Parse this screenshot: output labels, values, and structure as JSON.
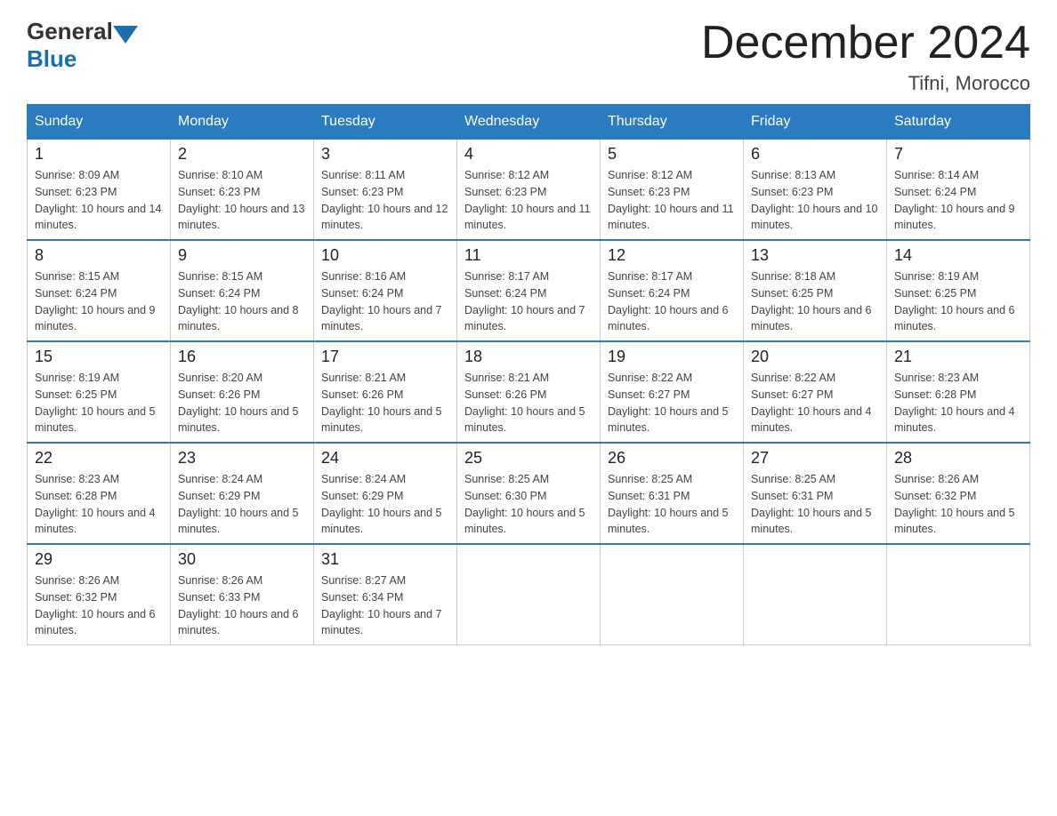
{
  "header": {
    "title": "December 2024",
    "location": "Tifni, Morocco",
    "logo_general": "General",
    "logo_blue": "Blue"
  },
  "days_of_week": [
    "Sunday",
    "Monday",
    "Tuesday",
    "Wednesday",
    "Thursday",
    "Friday",
    "Saturday"
  ],
  "weeks": [
    [
      {
        "day": "1",
        "sunrise": "8:09 AM",
        "sunset": "6:23 PM",
        "daylight": "10 hours and 14 minutes."
      },
      {
        "day": "2",
        "sunrise": "8:10 AM",
        "sunset": "6:23 PM",
        "daylight": "10 hours and 13 minutes."
      },
      {
        "day": "3",
        "sunrise": "8:11 AM",
        "sunset": "6:23 PM",
        "daylight": "10 hours and 12 minutes."
      },
      {
        "day": "4",
        "sunrise": "8:12 AM",
        "sunset": "6:23 PM",
        "daylight": "10 hours and 11 minutes."
      },
      {
        "day": "5",
        "sunrise": "8:12 AM",
        "sunset": "6:23 PM",
        "daylight": "10 hours and 11 minutes."
      },
      {
        "day": "6",
        "sunrise": "8:13 AM",
        "sunset": "6:23 PM",
        "daylight": "10 hours and 10 minutes."
      },
      {
        "day": "7",
        "sunrise": "8:14 AM",
        "sunset": "6:24 PM",
        "daylight": "10 hours and 9 minutes."
      }
    ],
    [
      {
        "day": "8",
        "sunrise": "8:15 AM",
        "sunset": "6:24 PM",
        "daylight": "10 hours and 9 minutes."
      },
      {
        "day": "9",
        "sunrise": "8:15 AM",
        "sunset": "6:24 PM",
        "daylight": "10 hours and 8 minutes."
      },
      {
        "day": "10",
        "sunrise": "8:16 AM",
        "sunset": "6:24 PM",
        "daylight": "10 hours and 7 minutes."
      },
      {
        "day": "11",
        "sunrise": "8:17 AM",
        "sunset": "6:24 PM",
        "daylight": "10 hours and 7 minutes."
      },
      {
        "day": "12",
        "sunrise": "8:17 AM",
        "sunset": "6:24 PM",
        "daylight": "10 hours and 6 minutes."
      },
      {
        "day": "13",
        "sunrise": "8:18 AM",
        "sunset": "6:25 PM",
        "daylight": "10 hours and 6 minutes."
      },
      {
        "day": "14",
        "sunrise": "8:19 AM",
        "sunset": "6:25 PM",
        "daylight": "10 hours and 6 minutes."
      }
    ],
    [
      {
        "day": "15",
        "sunrise": "8:19 AM",
        "sunset": "6:25 PM",
        "daylight": "10 hours and 5 minutes."
      },
      {
        "day": "16",
        "sunrise": "8:20 AM",
        "sunset": "6:26 PM",
        "daylight": "10 hours and 5 minutes."
      },
      {
        "day": "17",
        "sunrise": "8:21 AM",
        "sunset": "6:26 PM",
        "daylight": "10 hours and 5 minutes."
      },
      {
        "day": "18",
        "sunrise": "8:21 AM",
        "sunset": "6:26 PM",
        "daylight": "10 hours and 5 minutes."
      },
      {
        "day": "19",
        "sunrise": "8:22 AM",
        "sunset": "6:27 PM",
        "daylight": "10 hours and 5 minutes."
      },
      {
        "day": "20",
        "sunrise": "8:22 AM",
        "sunset": "6:27 PM",
        "daylight": "10 hours and 4 minutes."
      },
      {
        "day": "21",
        "sunrise": "8:23 AM",
        "sunset": "6:28 PM",
        "daylight": "10 hours and 4 minutes."
      }
    ],
    [
      {
        "day": "22",
        "sunrise": "8:23 AM",
        "sunset": "6:28 PM",
        "daylight": "10 hours and 4 minutes."
      },
      {
        "day": "23",
        "sunrise": "8:24 AM",
        "sunset": "6:29 PM",
        "daylight": "10 hours and 5 minutes."
      },
      {
        "day": "24",
        "sunrise": "8:24 AM",
        "sunset": "6:29 PM",
        "daylight": "10 hours and 5 minutes."
      },
      {
        "day": "25",
        "sunrise": "8:25 AM",
        "sunset": "6:30 PM",
        "daylight": "10 hours and 5 minutes."
      },
      {
        "day": "26",
        "sunrise": "8:25 AM",
        "sunset": "6:31 PM",
        "daylight": "10 hours and 5 minutes."
      },
      {
        "day": "27",
        "sunrise": "8:25 AM",
        "sunset": "6:31 PM",
        "daylight": "10 hours and 5 minutes."
      },
      {
        "day": "28",
        "sunrise": "8:26 AM",
        "sunset": "6:32 PM",
        "daylight": "10 hours and 5 minutes."
      }
    ],
    [
      {
        "day": "29",
        "sunrise": "8:26 AM",
        "sunset": "6:32 PM",
        "daylight": "10 hours and 6 minutes."
      },
      {
        "day": "30",
        "sunrise": "8:26 AM",
        "sunset": "6:33 PM",
        "daylight": "10 hours and 6 minutes."
      },
      {
        "day": "31",
        "sunrise": "8:27 AM",
        "sunset": "6:34 PM",
        "daylight": "10 hours and 7 minutes."
      },
      null,
      null,
      null,
      null
    ]
  ]
}
